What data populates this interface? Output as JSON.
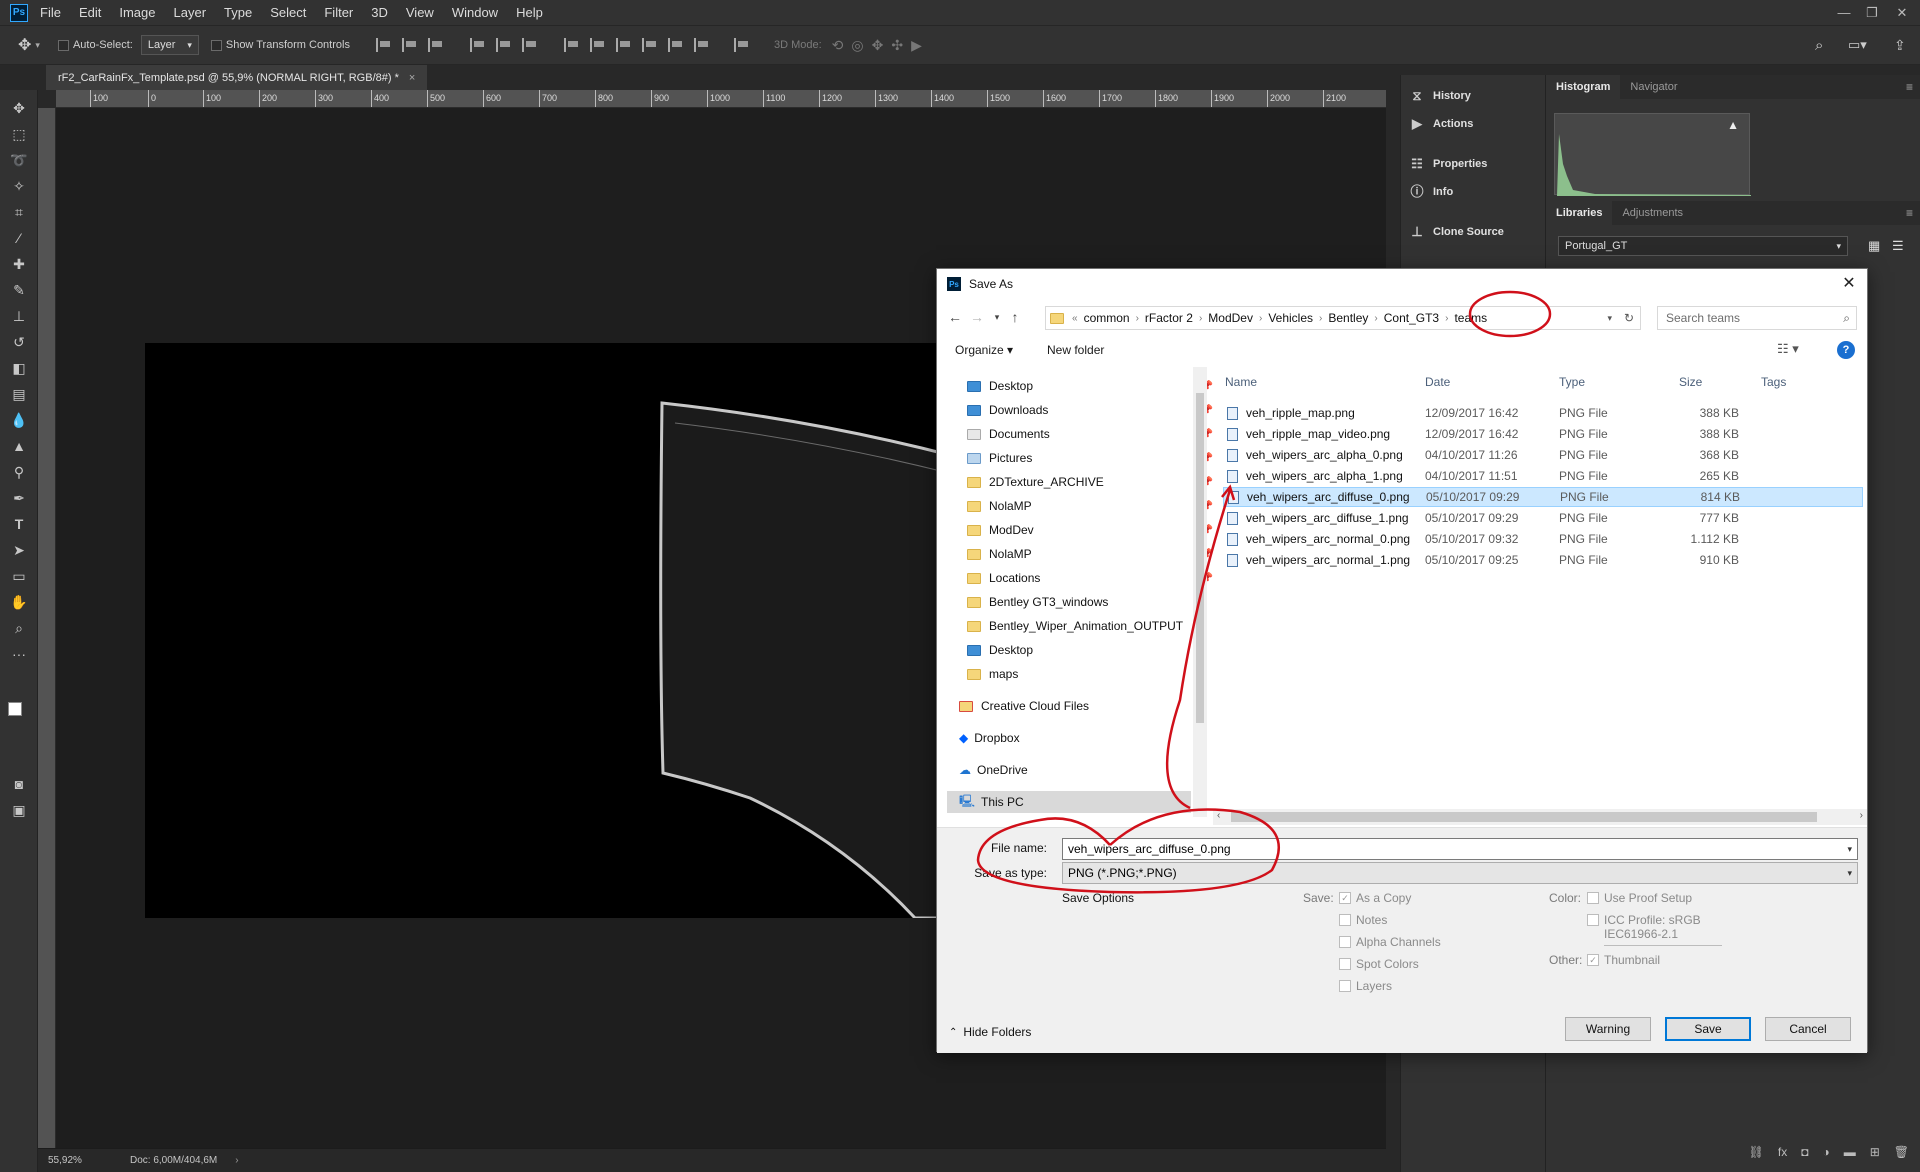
{
  "menu": [
    "File",
    "Edit",
    "Image",
    "Layer",
    "Type",
    "Select",
    "Filter",
    "3D",
    "View",
    "Window",
    "Help"
  ],
  "options_bar": {
    "auto_select_label": "Auto-Select:",
    "auto_select_value": "Layer",
    "transform_label": "Show Transform Controls",
    "mode_3d_label": "3D Mode:"
  },
  "document": {
    "tab_title": "rF2_CarRainFx_Template.psd @ 55,9% (NORMAL RIGHT, RGB/8#) *",
    "tab_close": "×"
  },
  "ruler_top": [
    "100",
    "0",
    "100",
    "200",
    "300",
    "400",
    "500",
    "600",
    "700",
    "800",
    "900",
    "1000",
    "1100",
    "1200",
    "1300",
    "1400",
    "1500",
    "1600",
    "1700",
    "1800",
    "1900",
    "2000",
    "2100"
  ],
  "status": {
    "zoom": "55,92%",
    "doc": "Doc: 6,00M/404,6M"
  },
  "dock": {
    "history": "History",
    "actions": "Actions",
    "properties": "Properties",
    "info": "Info",
    "clone_source": "Clone Source"
  },
  "panels": {
    "histogram_tab": "Histogram",
    "navigator_tab": "Navigator",
    "libraries_tab": "Libraries",
    "adjustments_tab": "Adjustments",
    "library_value": "Portugal_GT"
  },
  "dialog": {
    "title": "Save As",
    "close": "✕",
    "breadcrumb": [
      "common",
      "rFactor 2",
      "ModDev",
      "Vehicles",
      "Bentley",
      "Cont_GT3",
      "teams"
    ],
    "breadcrumb_overflow": "«",
    "search_placeholder": "Search teams",
    "organize": "Organize ▾",
    "new_folder": "New folder",
    "help": "?",
    "nav": {
      "pinned": [
        "Desktop",
        "Downloads",
        "Documents",
        "Pictures",
        "2DTexture_ARCHIVE",
        "NolaMP",
        "ModDev",
        "NolaMP",
        "Locations",
        "Bentley GT3_windows",
        "Bentley_Wiper_Animation_OUTPUT",
        "Desktop",
        "maps"
      ],
      "roots": [
        "Creative Cloud Files",
        "Dropbox",
        "OneDrive",
        "This PC"
      ]
    },
    "columns": {
      "name": "Name",
      "date": "Date",
      "type": "Type",
      "size": "Size",
      "tags": "Tags"
    },
    "files": [
      {
        "name": "veh_ripple_map.png",
        "date": "12/09/2017 16:42",
        "type": "PNG File",
        "size": "388 KB"
      },
      {
        "name": "veh_ripple_map_video.png",
        "date": "12/09/2017 16:42",
        "type": "PNG File",
        "size": "388 KB"
      },
      {
        "name": "veh_wipers_arc_alpha_0.png",
        "date": "04/10/2017 11:26",
        "type": "PNG File",
        "size": "368 KB"
      },
      {
        "name": "veh_wipers_arc_alpha_1.png",
        "date": "04/10/2017 11:51",
        "type": "PNG File",
        "size": "265 KB"
      },
      {
        "name": "veh_wipers_arc_diffuse_0.png",
        "date": "05/10/2017 09:29",
        "type": "PNG File",
        "size": "814 KB"
      },
      {
        "name": "veh_wipers_arc_diffuse_1.png",
        "date": "05/10/2017 09:29",
        "type": "PNG File",
        "size": "777 KB"
      },
      {
        "name": "veh_wipers_arc_normal_0.png",
        "date": "05/10/2017 09:32",
        "type": "PNG File",
        "size": "1.112 KB"
      },
      {
        "name": "veh_wipers_arc_normal_1.png",
        "date": "05/10/2017 09:25",
        "type": "PNG File",
        "size": "910 KB"
      }
    ],
    "file_name_label": "File name:",
    "file_name_value": "veh_wipers_arc_diffuse_0.png",
    "save_type_label": "Save as type:",
    "save_type_value": "PNG (*.PNG;*.PNG)",
    "save_options": "Save Options",
    "save_label": "Save:",
    "save_checks": [
      "As a Copy",
      "Notes",
      "Alpha Channels",
      "Spot Colors",
      "Layers"
    ],
    "color_label": "Color:",
    "use_proof": "Use Proof Setup",
    "icc_profile": "ICC Profile:  sRGB",
    "icc_profile_2": "IEC61966-2.1",
    "other_label": "Other:",
    "thumbnail": "Thumbnail",
    "hide_folders": "Hide Folders",
    "btn_warning": "Warning",
    "btn_save": "Save",
    "btn_cancel": "Cancel"
  },
  "colors": {
    "annotation_red": "#d0101a",
    "selection": "#cce8ff",
    "ps_blue": "#31a8ff"
  }
}
